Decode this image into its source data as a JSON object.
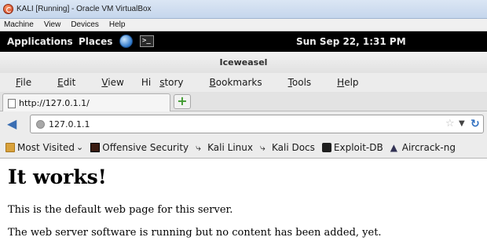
{
  "host_window": {
    "title": "KALI [Running] - Oracle VM VirtualBox",
    "menu": [
      "Machine",
      "View",
      "Devices",
      "Help"
    ]
  },
  "desktop_panel": {
    "applications": "Applications",
    "places": "Places",
    "clock": "Sun Sep 22,  1:31 PM"
  },
  "browser": {
    "window_title": "Iceweasel",
    "menu": [
      {
        "pre": "",
        "accel": "F",
        "post": "ile"
      },
      {
        "pre": "",
        "accel": "E",
        "post": "dit"
      },
      {
        "pre": "",
        "accel": "V",
        "post": "iew"
      },
      {
        "pre": "Hi",
        "accel": "s",
        "post": "tory"
      },
      {
        "pre": "",
        "accel": "B",
        "post": "ookmarks"
      },
      {
        "pre": "",
        "accel": "T",
        "post": "ools"
      },
      {
        "pre": "",
        "accel": "H",
        "post": "elp"
      }
    ],
    "tab_title": "http://127.0.1.1/",
    "new_tab_symbol": "+",
    "url": "127.0.1.1",
    "bookmarks": [
      {
        "label": "Most Visited",
        "icon": "folder-icon",
        "dropdown": "⌄"
      },
      {
        "label": "Offensive Security",
        "icon": "offensive-security-icon"
      },
      {
        "label": "Kali Linux",
        "icon": "kali-dragon-icon"
      },
      {
        "label": "Kali Docs",
        "icon": "kali-dragon-icon"
      },
      {
        "label": "Exploit-DB",
        "icon": "exploit-db-icon"
      },
      {
        "label": "Aircrack-ng",
        "icon": "aircrack-icon"
      }
    ]
  },
  "page": {
    "heading": "It works!",
    "paragraph_1": "This is the default web page for this server.",
    "paragraph_2": "The web server software is running but no content has been added, yet."
  }
}
